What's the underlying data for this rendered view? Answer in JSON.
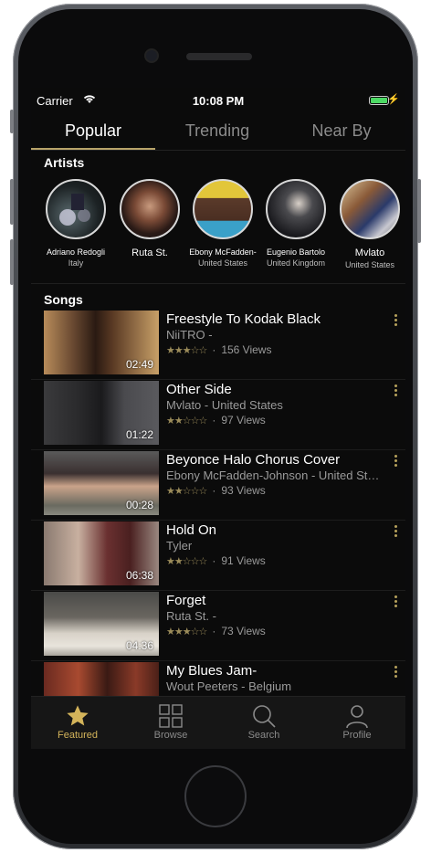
{
  "status_bar": {
    "carrier": "Carrier",
    "time": "10:08 PM"
  },
  "top_tabs": [
    {
      "label": "Popular",
      "active": true
    },
    {
      "label": "Trending",
      "active": false
    },
    {
      "label": "Near By",
      "active": false
    }
  ],
  "artists_section": {
    "title": "Artists",
    "items": [
      {
        "name": "Adriano Redogli",
        "country": "Italy"
      },
      {
        "name": "Ruta St.",
        "country": ""
      },
      {
        "name": "Ebony McFadden-",
        "country": "United States"
      },
      {
        "name": "Eugenio Bartolo",
        "country": "United Kingdom"
      },
      {
        "name": "Mvlato",
        "country": "United States"
      }
    ]
  },
  "songs_section": {
    "title": "Songs",
    "items": [
      {
        "title": "Freestyle To Kodak Black",
        "subtitle": "NiiTRO -",
        "rating": 3,
        "views": "156 Views",
        "duration": "02:49"
      },
      {
        "title": "Other Side",
        "subtitle": "Mvlato - United States",
        "rating": 2,
        "views": "97 Views",
        "duration": "01:22"
      },
      {
        "title": "Beyonce Halo Chorus Cover",
        "subtitle": "Ebony McFadden-Johnson - United States",
        "rating": 2,
        "views": "93 Views",
        "duration": "00:28"
      },
      {
        "title": "Hold On",
        "subtitle": "Tyler",
        "rating": 2,
        "views": "91 Views",
        "duration": "06:38"
      },
      {
        "title": "Forget",
        "subtitle": "Ruta St. -",
        "rating": 3,
        "views": "73 Views",
        "duration": "04:36"
      },
      {
        "title": "My Blues Jam-",
        "subtitle": "Wout Peeters - Belgium",
        "rating": 0,
        "views": "",
        "duration": ""
      }
    ]
  },
  "tab_bar": [
    {
      "label": "Featured",
      "icon": "star-icon",
      "active": true
    },
    {
      "label": "Browse",
      "icon": "grid-icon",
      "active": false
    },
    {
      "label": "Search",
      "icon": "search-icon",
      "active": false
    },
    {
      "label": "Profile",
      "icon": "person-icon",
      "active": false
    }
  ],
  "colors": {
    "accent": "#d4b45a",
    "background": "#0b0b0b",
    "star": "#9c8c5a"
  }
}
